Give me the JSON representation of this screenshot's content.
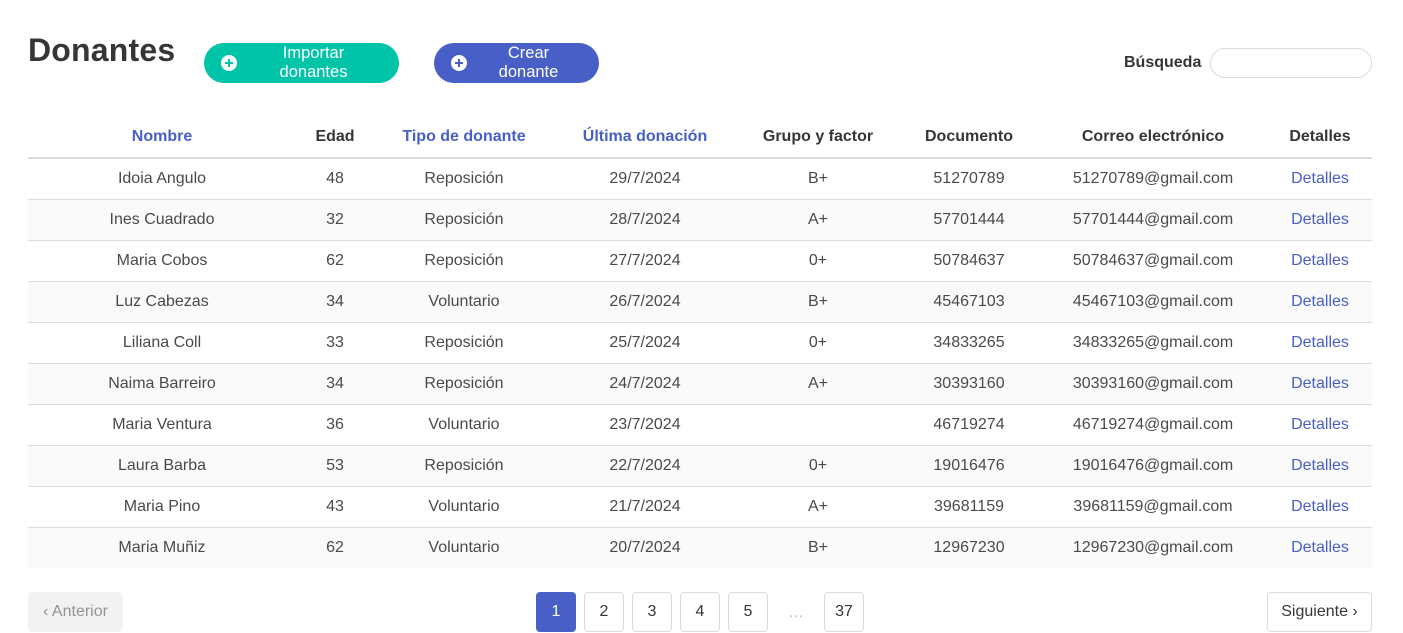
{
  "page": {
    "title": "Donantes"
  },
  "actions": {
    "import_label": "Importar donantes",
    "create_label": "Crear donante"
  },
  "search": {
    "label": "Búsqueda",
    "value": "",
    "placeholder": ""
  },
  "colors": {
    "primary": "#485fc7",
    "success": "#00c4a7"
  },
  "table": {
    "headers": {
      "nombre": "Nombre",
      "edad": "Edad",
      "tipo": "Tipo de donante",
      "ultima": "Última donación",
      "grupo": "Grupo y factor",
      "documento": "Documento",
      "correo": "Correo electrónico",
      "detalles": "Detalles"
    },
    "sortable_columns": [
      "Nombre",
      "Tipo de donante",
      "Última donación"
    ],
    "rows": [
      {
        "nombre": "Idoia Angulo",
        "edad": "48",
        "tipo": "Reposición",
        "ultima": "29/7/2024",
        "grupo": "B+",
        "documento": "51270789",
        "correo": "51270789@gmail.com",
        "detalles": "Detalles"
      },
      {
        "nombre": "Ines Cuadrado",
        "edad": "32",
        "tipo": "Reposición",
        "ultima": "28/7/2024",
        "grupo": "A+",
        "documento": "57701444",
        "correo": "57701444@gmail.com",
        "detalles": "Detalles"
      },
      {
        "nombre": "Maria Cobos",
        "edad": "62",
        "tipo": "Reposición",
        "ultima": "27/7/2024",
        "grupo": "0+",
        "documento": "50784637",
        "correo": "50784637@gmail.com",
        "detalles": "Detalles"
      },
      {
        "nombre": "Luz Cabezas",
        "edad": "34",
        "tipo": "Voluntario",
        "ultima": "26/7/2024",
        "grupo": "B+",
        "documento": "45467103",
        "correo": "45467103@gmail.com",
        "detalles": "Detalles"
      },
      {
        "nombre": "Liliana Coll",
        "edad": "33",
        "tipo": "Reposición",
        "ultima": "25/7/2024",
        "grupo": "0+",
        "documento": "34833265",
        "correo": "34833265@gmail.com",
        "detalles": "Detalles"
      },
      {
        "nombre": "Naima Barreiro",
        "edad": "34",
        "tipo": "Reposición",
        "ultima": "24/7/2024",
        "grupo": "A+",
        "documento": "30393160",
        "correo": "30393160@gmail.com",
        "detalles": "Detalles"
      },
      {
        "nombre": "Maria Ventura",
        "edad": "36",
        "tipo": "Voluntario",
        "ultima": "23/7/2024",
        "grupo": "",
        "documento": "46719274",
        "correo": "46719274@gmail.com",
        "detalles": "Detalles"
      },
      {
        "nombre": "Laura Barba",
        "edad": "53",
        "tipo": "Reposición",
        "ultima": "22/7/2024",
        "grupo": "0+",
        "documento": "19016476",
        "correo": "19016476@gmail.com",
        "detalles": "Detalles"
      },
      {
        "nombre": "Maria Pino",
        "edad": "43",
        "tipo": "Voluntario",
        "ultima": "21/7/2024",
        "grupo": "A+",
        "documento": "39681159",
        "correo": "39681159@gmail.com",
        "detalles": "Detalles"
      },
      {
        "nombre": "Maria Muñiz",
        "edad": "62",
        "tipo": "Voluntario",
        "ultima": "20/7/2024",
        "grupo": "B+",
        "documento": "12967230",
        "correo": "12967230@gmail.com",
        "detalles": "Detalles"
      }
    ]
  },
  "pagination": {
    "prev_label": "‹ Anterior",
    "next_label": "Siguiente ›",
    "pages": [
      "1",
      "2",
      "3",
      "4",
      "5"
    ],
    "ellipsis": "…",
    "last_page": "37",
    "current_page": "1"
  }
}
